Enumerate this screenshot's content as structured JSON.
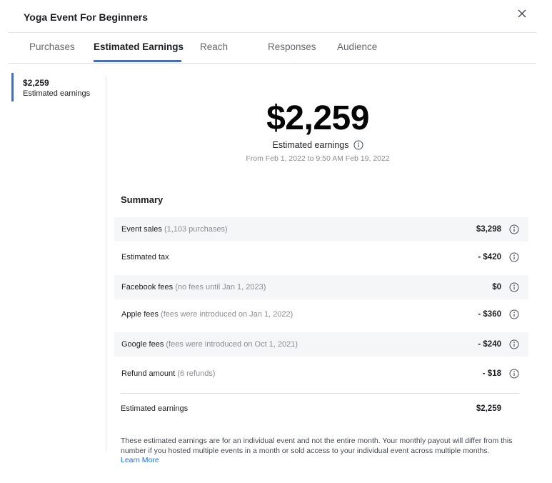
{
  "header": {
    "title": "Yoga Event For Beginners"
  },
  "tabs": [
    {
      "label": "Purchases",
      "active": false
    },
    {
      "label": "Estimated Earnings",
      "active": true
    },
    {
      "label": "Reach",
      "active": false
    },
    {
      "label": "Responses",
      "active": false
    },
    {
      "label": "Audience",
      "active": false
    }
  ],
  "sidebar": {
    "value": "$2,259",
    "label": "Estimated earnings"
  },
  "hero": {
    "amount": "$2,259",
    "label": "Estimated earnings",
    "date_range": "From Feb 1, 2022 to 9:50 AM Feb 19, 2022"
  },
  "summary": {
    "title": "Summary",
    "rows": [
      {
        "label": "Event sales",
        "note": "(1,103 purchases)",
        "amount": "$3,298"
      },
      {
        "label": "Estimated tax",
        "note": "",
        "amount": "- $420"
      },
      {
        "label": "Facebook fees",
        "note": "(no fees until Jan 1, 2023)",
        "amount": "$0"
      },
      {
        "label": "Apple fees",
        "note": "(fees were introduced on Jan 1, 2022)",
        "amount": "- $360"
      },
      {
        "label": "Google fees",
        "note": "(fees were introduced on Oct 1, 2021)",
        "amount": "- $240"
      },
      {
        "label": "Refund amount",
        "note": "(6 refunds)",
        "amount": "- $18"
      }
    ],
    "total_label": "Estimated earnings",
    "total_amount": "$2,259"
  },
  "footer": {
    "note": "These estimated earnings are for an individual event and not the entire month. Your monthly payout will differ from this number if you hosted multiple events in a month or sold access to your individual event across multiple months.",
    "learn_more": "Learn More"
  },
  "colors": {
    "accent": "#4a6cb0",
    "link": "#216fdb",
    "row_shade": "#f5f6f7"
  },
  "icons": {
    "close": "close-icon",
    "info": "info-icon"
  }
}
